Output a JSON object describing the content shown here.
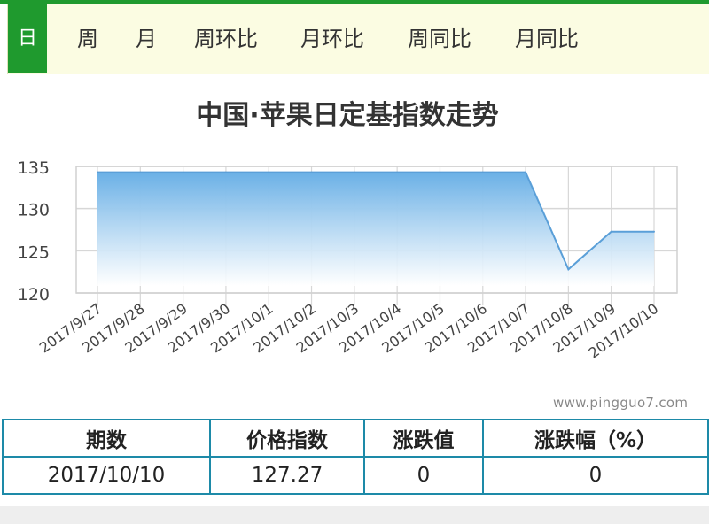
{
  "tabs": [
    "日",
    "周",
    "月",
    "周环比",
    "月环比",
    "周同比",
    "月同比"
  ],
  "active_tab": "日",
  "watermark": "www.pingguo7.com",
  "colors": {
    "accent": "#1f9a2e",
    "series_line": "#5a9fd8",
    "area_top": "#6ab0e6",
    "table_border": "#1d8aa8"
  },
  "chart_data": {
    "type": "area",
    "title": "中国·苹果日定基指数走势",
    "categories": [
      "2017/9/27",
      "2017/9/28",
      "2017/9/29",
      "2017/9/30",
      "2017/10/1",
      "2017/10/2",
      "2017/10/3",
      "2017/10/4",
      "2017/10/5",
      "2017/10/6",
      "2017/10/7",
      "2017/10/8",
      "2017/10/9",
      "2017/10/10"
    ],
    "series": [
      {
        "values": [
          134.3,
          134.3,
          134.3,
          134.3,
          134.3,
          134.3,
          134.3,
          134.3,
          134.3,
          134.3,
          134.3,
          122.8,
          127.27,
          127.27
        ]
      }
    ],
    "ylim": [
      120,
      135
    ],
    "yticks": [
      120,
      125,
      130,
      135
    ],
    "grid": true,
    "legend": "none"
  },
  "table": {
    "headers": [
      "期数",
      "价格指数",
      "涨跌值",
      "涨跌幅（%）"
    ],
    "rows": [
      [
        "2017/10/10",
        "127.27",
        "0",
        "0"
      ]
    ]
  }
}
